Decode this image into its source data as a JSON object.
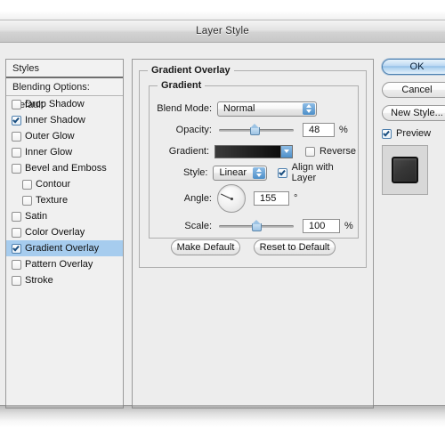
{
  "window": {
    "title": "Layer Style"
  },
  "sidebar": {
    "header": "Styles",
    "subheader": "Blending Options: Default",
    "items": [
      {
        "label": "Drop Shadow",
        "checked": false,
        "indent": false,
        "selected": false
      },
      {
        "label": "Inner Shadow",
        "checked": true,
        "indent": false,
        "selected": false
      },
      {
        "label": "Outer Glow",
        "checked": false,
        "indent": false,
        "selected": false
      },
      {
        "label": "Inner Glow",
        "checked": false,
        "indent": false,
        "selected": false
      },
      {
        "label": "Bevel and Emboss",
        "checked": false,
        "indent": false,
        "selected": false
      },
      {
        "label": "Contour",
        "checked": false,
        "indent": true,
        "selected": false
      },
      {
        "label": "Texture",
        "checked": false,
        "indent": true,
        "selected": false
      },
      {
        "label": "Satin",
        "checked": false,
        "indent": false,
        "selected": false
      },
      {
        "label": "Color Overlay",
        "checked": false,
        "indent": false,
        "selected": false
      },
      {
        "label": "Gradient Overlay",
        "checked": true,
        "indent": false,
        "selected": true
      },
      {
        "label": "Pattern Overlay",
        "checked": false,
        "indent": false,
        "selected": false
      },
      {
        "label": "Stroke",
        "checked": false,
        "indent": false,
        "selected": false
      }
    ],
    "selection_color": "#a6ccee"
  },
  "main": {
    "group_title": "Gradient Overlay",
    "subgroup_title": "Gradient",
    "blend_mode": {
      "label": "Blend Mode:",
      "value": "Normal"
    },
    "opacity": {
      "label": "Opacity:",
      "value": "48",
      "unit": "%",
      "percent": 48
    },
    "gradient": {
      "label": "Gradient:",
      "start_color": "#3a3a3a",
      "end_color": "#0c0c0c",
      "reverse_label": "Reverse",
      "reverse_checked": false
    },
    "style": {
      "label": "Style:",
      "value": "Linear"
    },
    "align": {
      "label": "Align with Layer",
      "checked": true
    },
    "angle": {
      "label": "Angle:",
      "value": "155",
      "unit": "°",
      "degrees": 155
    },
    "scale": {
      "label": "Scale:",
      "value": "100",
      "unit": "%",
      "percent": 50
    },
    "make_default": "Make Default",
    "reset_to_default": "Reset to Default"
  },
  "right": {
    "ok": "OK",
    "cancel": "Cancel",
    "new_style": "New Style...",
    "preview": {
      "label": "Preview",
      "checked": true
    }
  }
}
